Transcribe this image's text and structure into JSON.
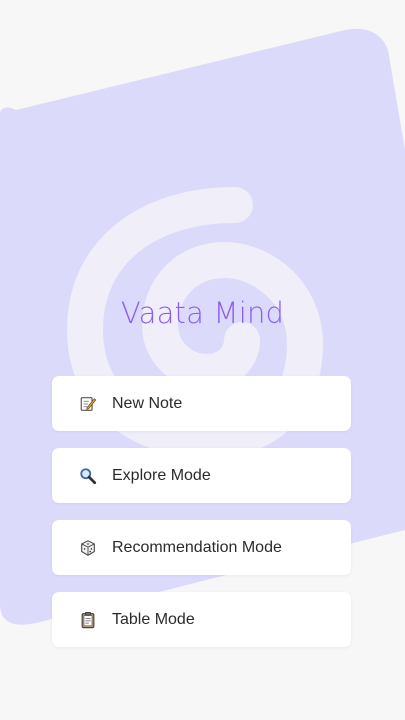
{
  "app": {
    "title": "Vaata Mind"
  },
  "menu": {
    "items": [
      {
        "label": "New Note",
        "icon": "memo-icon"
      },
      {
        "label": "Explore Mode",
        "icon": "magnifier-icon"
      },
      {
        "label": "Recommendation Mode",
        "icon": "dice-icon"
      },
      {
        "label": "Table Mode",
        "icon": "clipboard-icon"
      }
    ]
  },
  "colors": {
    "background": "#f7f7f8",
    "blob": "#dcdafb",
    "swirl": "#efeef9",
    "title": "#8b5cf6",
    "button": "#ffffff"
  }
}
